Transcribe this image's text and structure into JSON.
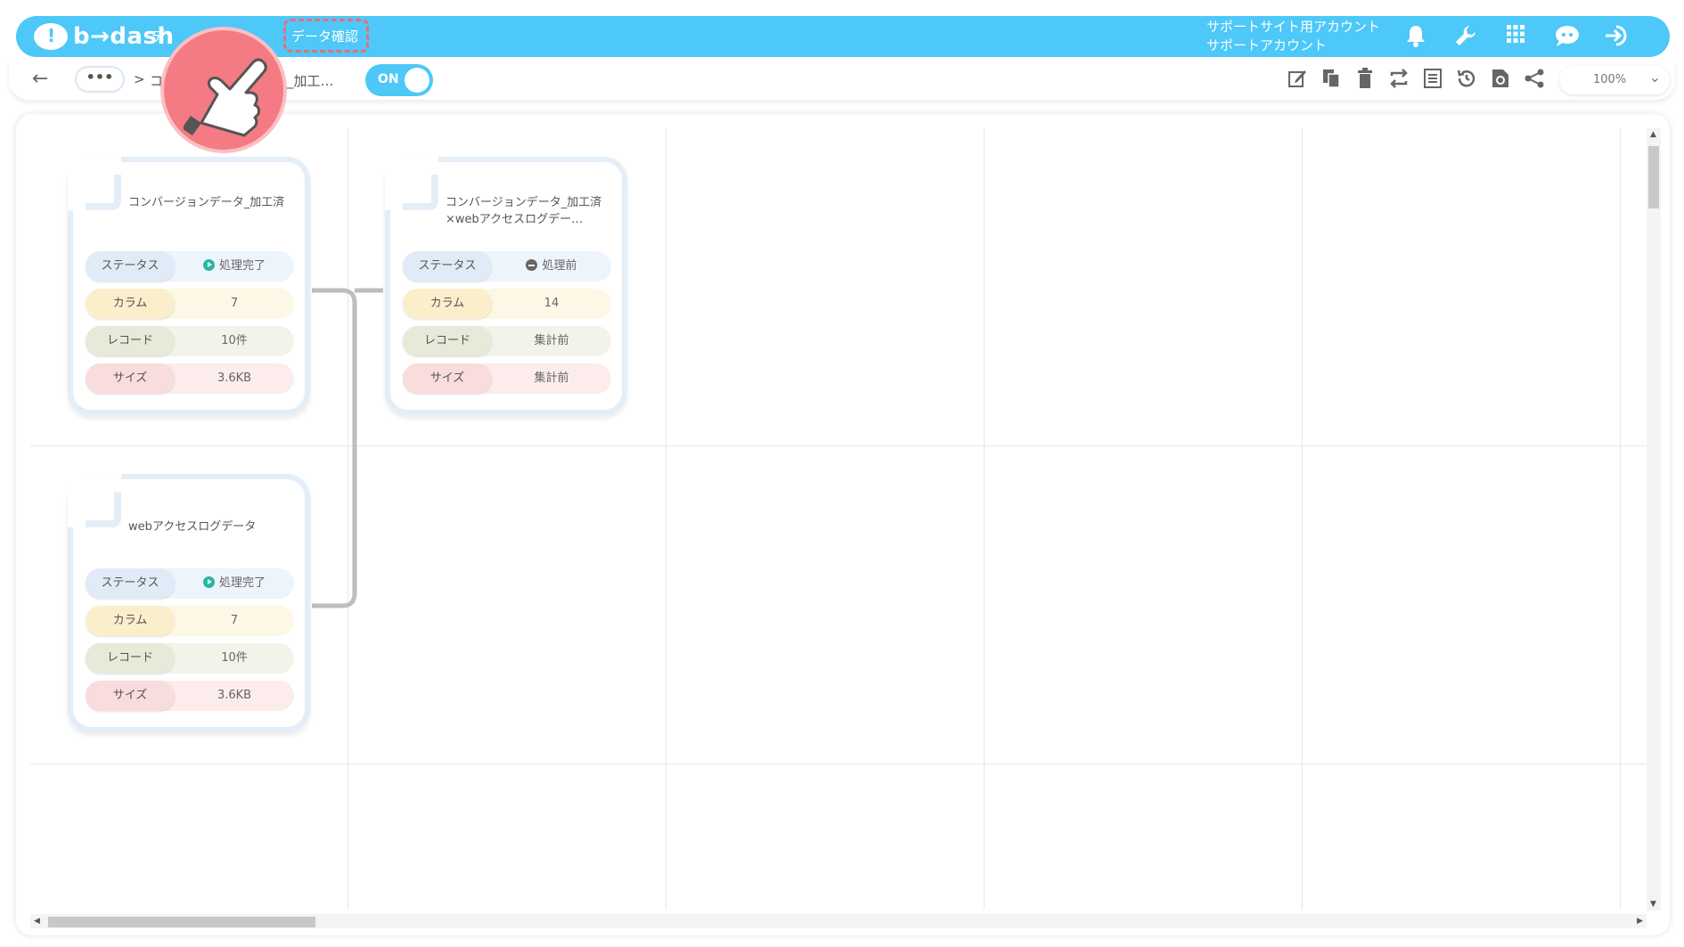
{
  "header": {
    "brand": "b→dash",
    "menu_partial": "デ",
    "menu_active": "データ確認",
    "account_line1": "サポートサイト用アカウント",
    "account_line2": "サポートアカウント",
    "icons": [
      "bell-icon",
      "wrench-icon",
      "apps-grid-icon",
      "chat-bot-icon",
      "logout-icon"
    ]
  },
  "toolbar": {
    "back_icon": "←",
    "breadcrumb_more": "•••",
    "breadcrumb_sep": ">",
    "breadcrumb_partial": "コ",
    "breadcrumb_current": "_加工…",
    "toggle_label": "ON",
    "zoom_value": "100%",
    "icons": [
      "edit-icon",
      "copy-icon",
      "trash-icon",
      "swap-icon",
      "list-icon",
      "history-icon",
      "reload-icon",
      "share-icon"
    ]
  },
  "labels": {
    "status": "ステータス",
    "columns": "カラム",
    "records": "レコード",
    "size": "サイズ"
  },
  "nodes": [
    {
      "title": "コンバージョンデータ_加工済",
      "status": "処理完了",
      "status_kind": "done",
      "columns": "7",
      "records": "10件",
      "size": "3.6KB"
    },
    {
      "title": "コンバージョンデータ_加工済×webアクセスログデー…",
      "status": "処理前",
      "status_kind": "pending",
      "columns": "14",
      "records": "集計前",
      "size": "集計前"
    },
    {
      "title": "webアクセスログデータ",
      "status": "処理完了",
      "status_kind": "done",
      "columns": "7",
      "records": "10件",
      "size": "3.6KB"
    }
  ],
  "colors": {
    "header_bg": "#4dc8f8",
    "highlight": "#f06a78",
    "status_done": "#29b5a4"
  }
}
